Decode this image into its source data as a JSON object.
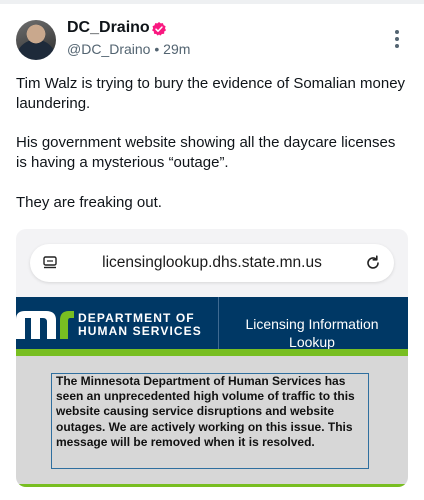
{
  "post": {
    "author_name": "DC_Draino",
    "handle": "@DC_Draino",
    "separator": "•",
    "time": "29m",
    "paragraphs": [
      "Tim Walz is trying to bury the evidence of Somalian money laundering.",
      "His government website showing all the daycare licenses is having a mysterious “outage”.",
      "They are freaking out."
    ],
    "icons": [
      "verified-badge-icon",
      "more-options-icon"
    ],
    "colors": {
      "verified": "#f91880",
      "secondary_text": "#536471"
    }
  },
  "screenshot": {
    "url": "licensinglookup.dhs.state.mn.us",
    "department_line1": "DEPARTMENT OF",
    "department_line2": "HUMAN SERVICES",
    "site_title": "Licensing Information Lookup",
    "notice": "The Minnesota Department of Human Services has seen an unprecedented high volume of traffic to this website causing service disruptions and website outages. We are actively working on this issue. This message will be removed when it is resolved.",
    "colors": {
      "banner": "#003865",
      "accent_green": "#78be21",
      "notice_bg": "#d7d7d7"
    }
  }
}
